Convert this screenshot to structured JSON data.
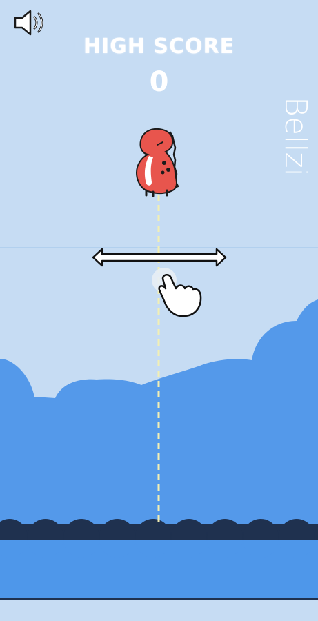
{
  "hud": {
    "sound_icon": "speaker-on-icon",
    "high_score_label": "HIGH SCORE",
    "high_score_value": "0"
  },
  "branding": {
    "text": "Bellzi"
  },
  "player": {
    "character": "red-dinosaur"
  },
  "tutorial": {
    "gesture": "drag-left-right",
    "icon": "pointing-hand-icon"
  },
  "colors": {
    "sky": "#c6dcf3",
    "clouds": "#5499ea",
    "wave_band": "#1f314f",
    "water": "#4e97ea",
    "dino": "#e8554d",
    "guide_line": "#f3efb3"
  }
}
